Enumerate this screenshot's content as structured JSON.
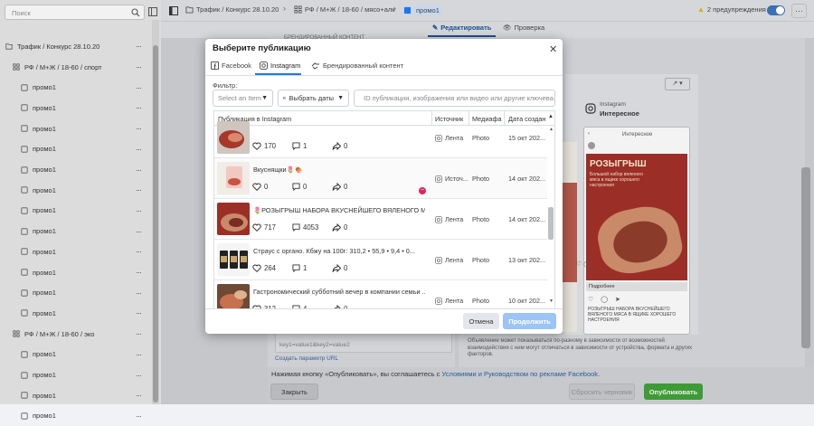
{
  "sidebar": {
    "search_placeholder": "Поиск",
    "campaign": "Трафик / Конкурс 28.10.20",
    "adsets": [
      {
        "label": "РФ / М+Ж / 18-60 / спорт",
        "ads": [
          "промо1",
          "промо1",
          "промо1",
          "промо1",
          "промо1",
          "промо1",
          "промо1",
          "промо1",
          "промо1",
          "промо1",
          "промо1",
          "промо1"
        ]
      },
      {
        "label": "РФ / М+Ж / 18-60 / эко",
        "ads": [
          "промо1",
          "промо1",
          "промо1",
          "промо1"
        ]
      }
    ],
    "more_icon": "···"
  },
  "topbar": {
    "crumb1": "Трафик / Конкурс 28.10.20",
    "crumb2": "РФ / М+Ж / 18-60 / мясо+алк",
    "crumb3": "промо1",
    "warnings": "2 предупреждения"
  },
  "editor_tabs": {
    "edit": "Редактировать",
    "review": "Проверка"
  },
  "underlying": {
    "section_heading": "БРЕНДИРОВАННЫЙ КОНТЕНТ",
    "url_params": "key1=value1&key2=value2",
    "create_param": "Создать параметр URL",
    "preview_platform": "Instagram",
    "preview_type": "Интересное",
    "preview_note": "Объявление может показываться по-разному в зависимости от возможностей взаимодействия с ним могут отличаться в зависимости от устройства, формата и других факторов.",
    "footer_note_pre": "Нажимая кнопку «Опубликовать», вы соглашаетесь с ",
    "footer_note_link": "Условиями и Руководством по рекламе Facebook.",
    "close_button": "Закрыть",
    "draft_button": "Сбросить черновик",
    "publish_button": "Опубликовать",
    "mock_header": "Интересное",
    "mock_promo_title": "РОЗЫГРЫШ",
    "mock_promo_sub": "Большой набор вяленого мяса в ящике хорошего настроения",
    "mock_more": "Подробнее",
    "mock_caption": "РОЗЫГРЫШ НАБОРА ВКУСНЕЙШЕГО ВЯЛЕНОГО МЯСА В ЯЩИКЕ ХОРОШЕГО НАСТРОЕНИЯ"
  },
  "modal": {
    "title": "Выберите публикацию",
    "tabs": [
      "Facebook",
      "Instagram",
      "Брендированный контент"
    ],
    "filter_label": "Фильтр:",
    "select_item": "Select an Item",
    "date_select": "Выбрать даты",
    "search_placeholder": "ID публикации, изображения или видео или другие ключева...",
    "columns": [
      "Публикация в Instagram",
      "Источник",
      "Медиафа",
      "Дата создан"
    ],
    "rows": [
      {
        "caption": "",
        "likes": "170",
        "comments": "1",
        "shares": "0",
        "source": "Лента",
        "media": "Photo",
        "date": "15 окт 202...",
        "thumb": "food1"
      },
      {
        "caption": "Вкуснящки🌷🍖",
        "likes": "0",
        "comments": "0",
        "shares": "0",
        "source": "Источ...",
        "media": "Photo",
        "date": "14 окт 202...",
        "thumb": "food2"
      },
      {
        "caption": "🌷РОЗЫГРЫШ НАБОРА ВКУСНЕЙШЕГО ВЯЛЕНОГО МЯС...",
        "likes": "717",
        "comments": "4053",
        "shares": "0",
        "source": "Лента",
        "media": "Photo",
        "date": "14 окт 202...",
        "thumb": "food3"
      },
      {
        "caption": "Страус с органо.    Кбжу на 100г: 310,2 • 55,9 • 9,4 • 0...",
        "likes": "264",
        "comments": "1",
        "shares": "0",
        "source": "Лента",
        "media": "Photo",
        "date": "13 окт 202...",
        "thumb": "jars"
      },
      {
        "caption": "Гастрономический субботний вечер в компании семьи ...",
        "likes": "312",
        "comments": "4",
        "shares": "0",
        "source": "Лента",
        "media": "Photo",
        "date": "10 окт 202...",
        "thumb": "food4"
      }
    ],
    "cancel": "Отмена",
    "continue": "Продолжить"
  },
  "colors": {
    "accent": "#1877f2",
    "publish": "#42b72a",
    "sidebar": "#dcdcdc",
    "overlay": "#c5c7ca"
  }
}
